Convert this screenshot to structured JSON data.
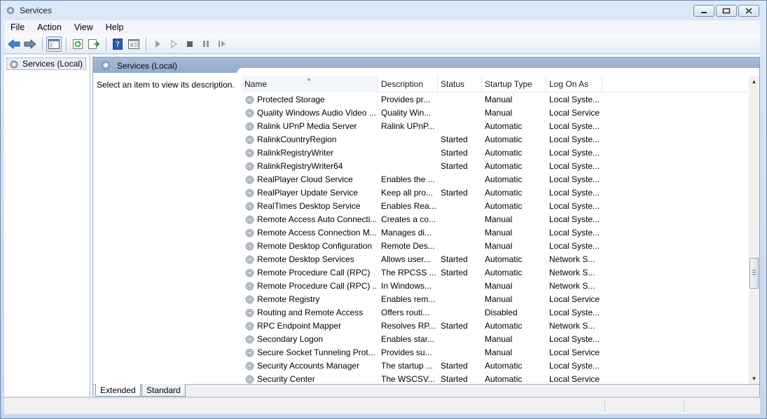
{
  "window": {
    "title": "Services",
    "controls": [
      "minimize-icon",
      "maximize-icon",
      "close-icon"
    ]
  },
  "menubar": {
    "items": [
      "File",
      "Action",
      "View",
      "Help"
    ]
  },
  "toolbar": {
    "buttons": [
      "back-arrow-icon",
      "forward-arrow-icon",
      "show-hide-tree-icon",
      "refresh-icon",
      "export-list-icon",
      "help-icon",
      "properties-icon",
      "start-service-icon",
      "start-service-alt-icon",
      "stop-service-icon",
      "pause-service-icon",
      "restart-service-icon"
    ]
  },
  "tree": {
    "item_label": "Services (Local)"
  },
  "main": {
    "header_title": "Services (Local)",
    "description_text": "Select an item to view its description."
  },
  "list": {
    "columns": [
      "Name",
      "Description",
      "Status",
      "Startup Type",
      "Log On As"
    ],
    "sorted_column": "Name",
    "rows": [
      {
        "name": "Protected Storage",
        "description": "Provides pr...",
        "status": "",
        "startup": "Manual",
        "logon": "Local Syste..."
      },
      {
        "name": "Quality Windows Audio Video ...",
        "description": "Quality Win...",
        "status": "",
        "startup": "Manual",
        "logon": "Local Service"
      },
      {
        "name": "Ralink UPnP Media Server",
        "description": "Ralink UPnP...",
        "status": "",
        "startup": "Automatic",
        "logon": "Local Syste..."
      },
      {
        "name": "RalinkCountryRegion",
        "description": "",
        "status": "Started",
        "startup": "Automatic",
        "logon": "Local Syste..."
      },
      {
        "name": "RalinkRegistryWriter",
        "description": "",
        "status": "Started",
        "startup": "Automatic",
        "logon": "Local Syste..."
      },
      {
        "name": "RalinkRegistryWriter64",
        "description": "",
        "status": "Started",
        "startup": "Automatic",
        "logon": "Local Syste..."
      },
      {
        "name": "RealPlayer Cloud Service",
        "description": "Enables the ...",
        "status": "",
        "startup": "Automatic",
        "logon": "Local Syste..."
      },
      {
        "name": "RealPlayer Update Service",
        "description": "Keep all pro...",
        "status": "Started",
        "startup": "Automatic",
        "logon": "Local Syste..."
      },
      {
        "name": "RealTimes Desktop Service",
        "description": "Enables Rea...",
        "status": "",
        "startup": "Automatic",
        "logon": "Local Syste..."
      },
      {
        "name": "Remote Access Auto Connecti...",
        "description": "Creates a co...",
        "status": "",
        "startup": "Manual",
        "logon": "Local Syste..."
      },
      {
        "name": "Remote Access Connection M...",
        "description": "Manages di...",
        "status": "",
        "startup": "Manual",
        "logon": "Local Syste..."
      },
      {
        "name": "Remote Desktop Configuration",
        "description": "Remote Des...",
        "status": "",
        "startup": "Manual",
        "logon": "Local Syste..."
      },
      {
        "name": "Remote Desktop Services",
        "description": "Allows user...",
        "status": "Started",
        "startup": "Automatic",
        "logon": "Network S..."
      },
      {
        "name": "Remote Procedure Call (RPC)",
        "description": "The RPCSS ...",
        "status": "Started",
        "startup": "Automatic",
        "logon": "Network S..."
      },
      {
        "name": "Remote Procedure Call (RPC) ...",
        "description": "In Windows...",
        "status": "",
        "startup": "Manual",
        "logon": "Network S..."
      },
      {
        "name": "Remote Registry",
        "description": "Enables rem...",
        "status": "",
        "startup": "Manual",
        "logon": "Local Service"
      },
      {
        "name": "Routing and Remote Access",
        "description": "Offers routi...",
        "status": "",
        "startup": "Disabled",
        "logon": "Local Syste..."
      },
      {
        "name": "RPC Endpoint Mapper",
        "description": "Resolves RP...",
        "status": "Started",
        "startup": "Automatic",
        "logon": "Network S..."
      },
      {
        "name": "Secondary Logon",
        "description": "Enables star...",
        "status": "",
        "startup": "Manual",
        "logon": "Local Syste..."
      },
      {
        "name": "Secure Socket Tunneling Prot...",
        "description": "Provides su...",
        "status": "",
        "startup": "Manual",
        "logon": "Local Service"
      },
      {
        "name": "Security Accounts Manager",
        "description": "The startup ...",
        "status": "Started",
        "startup": "Automatic",
        "logon": "Local Syste..."
      },
      {
        "name": "Security Center",
        "description": "The WSCSV...",
        "status": "Started",
        "startup": "Automatic",
        "logon": "Local Service"
      }
    ]
  },
  "tabs": [
    "Extended",
    "Standard"
  ],
  "colors": {
    "frame": "#c9d9ee",
    "header_band": "#9fb4d1",
    "accent_blue": "#2f6fc1"
  }
}
